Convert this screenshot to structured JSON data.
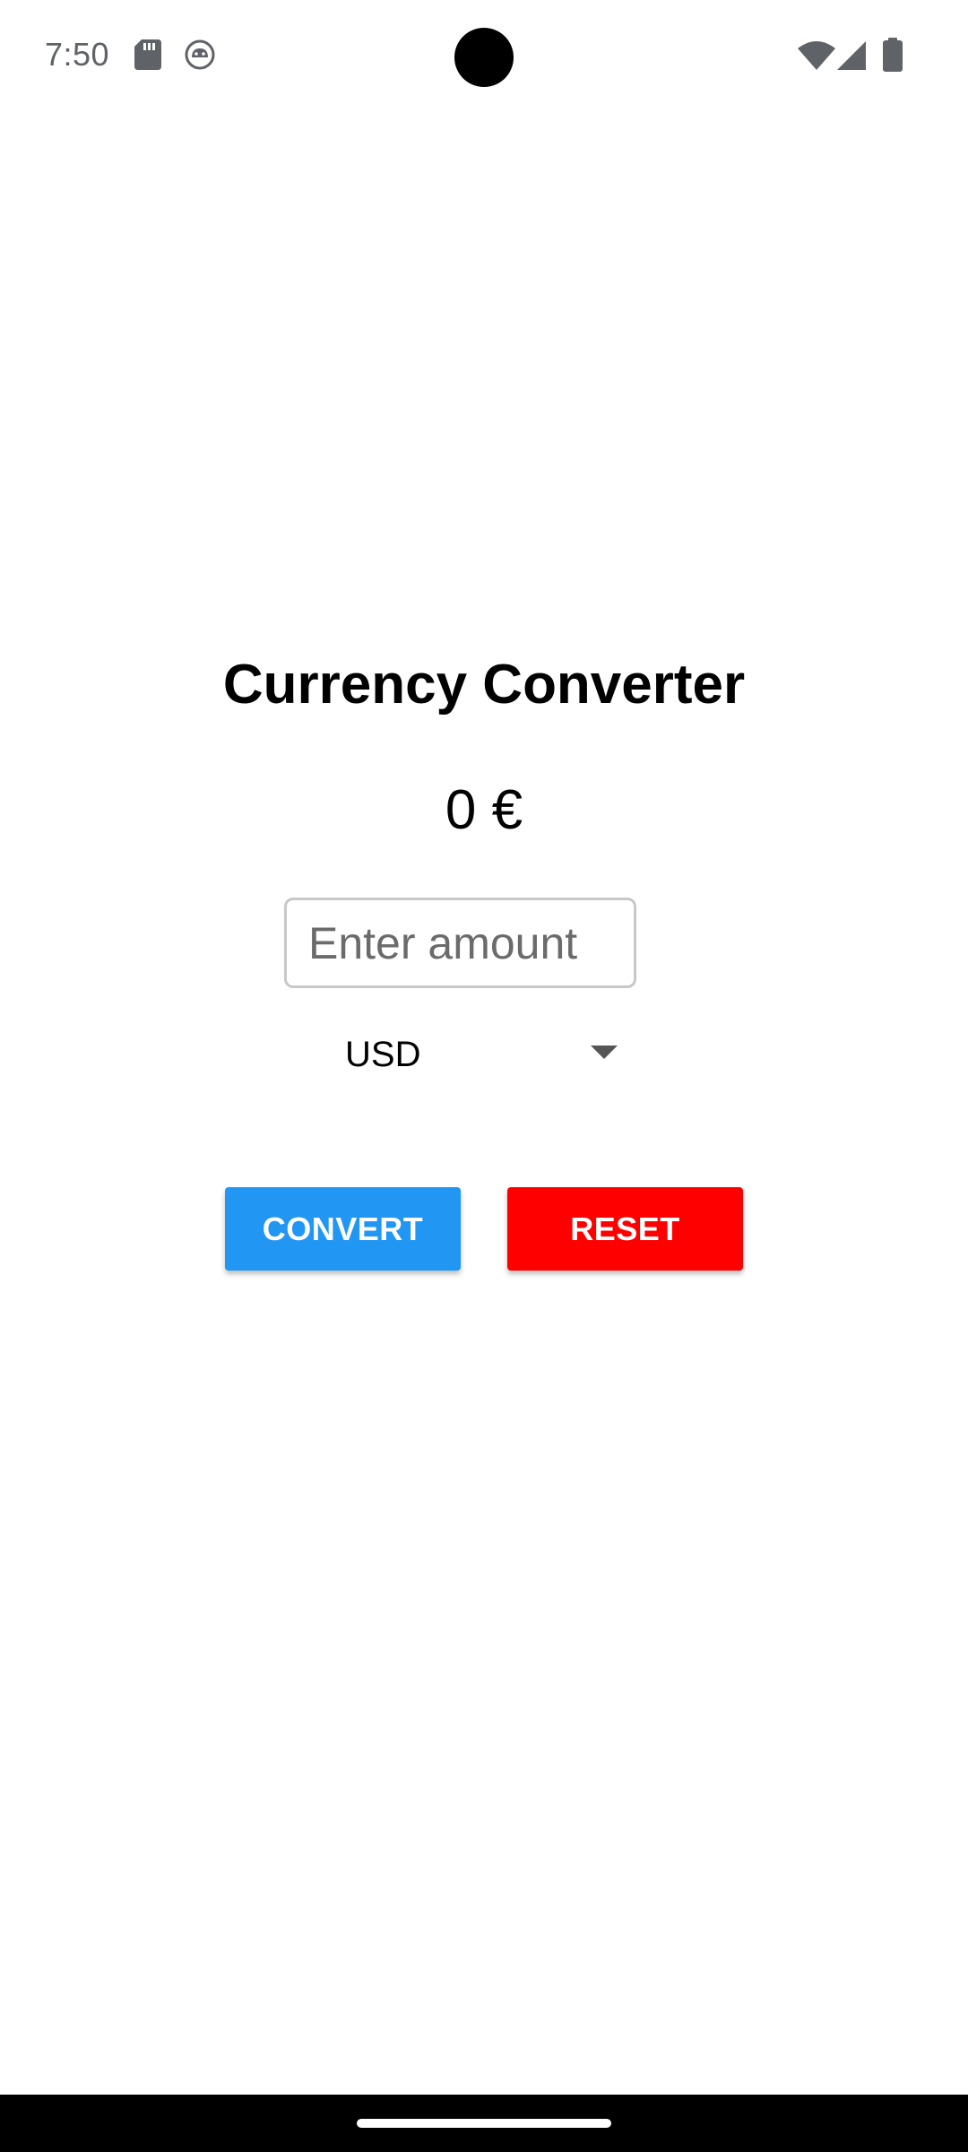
{
  "status_bar": {
    "time": "7:50",
    "left_icons": [
      "sd-card-icon",
      "android-debug-icon"
    ],
    "right_icons": [
      "wifi-icon",
      "cell-signal-icon",
      "battery-icon"
    ]
  },
  "app": {
    "title": "Currency Converter",
    "result": "0 €",
    "amount_input": {
      "placeholder": "Enter amount",
      "value": ""
    },
    "currency_select": {
      "selected": "USD"
    },
    "buttons": {
      "convert_label": "CONVERT",
      "reset_label": "RESET"
    },
    "colors": {
      "convert": "#2196F3",
      "reset": "#FF0000"
    }
  },
  "navigation": {
    "handle": "gesture-handle"
  }
}
